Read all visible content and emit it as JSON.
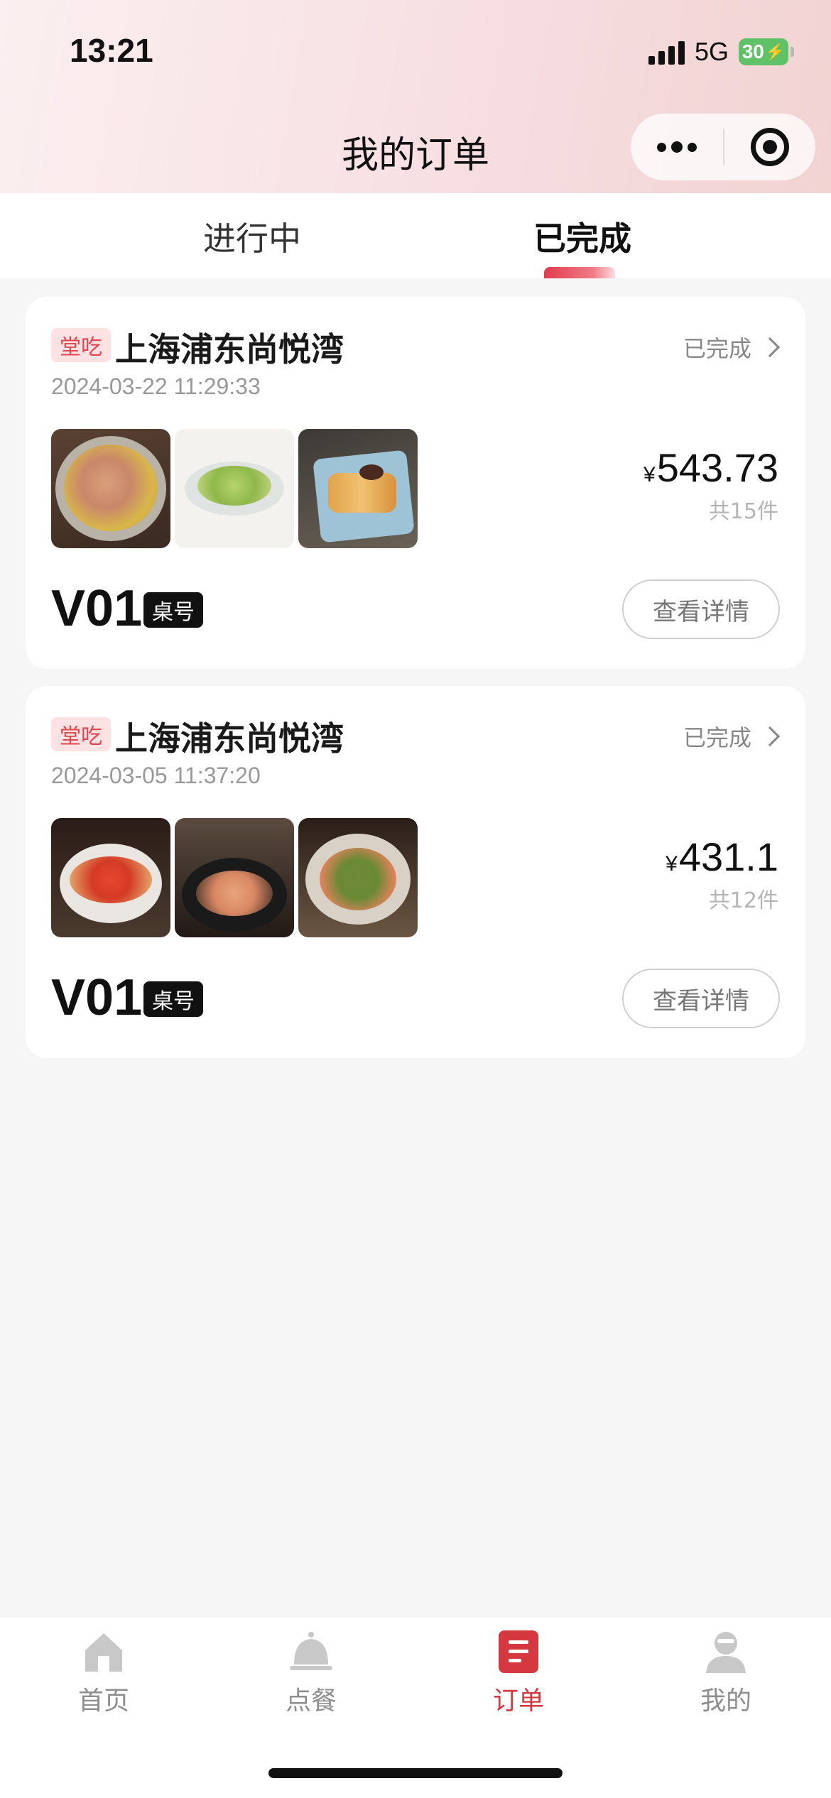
{
  "status_bar": {
    "time": "13:21",
    "network": "5G",
    "battery": "30"
  },
  "nav": {
    "title": "我的订单"
  },
  "tabs": [
    {
      "label": "进行中",
      "active": false
    },
    {
      "label": "已完成",
      "active": true
    }
  ],
  "orders": [
    {
      "tag": "堂吃",
      "store": "上海浦东尚悦湾",
      "status": "已完成",
      "datetime": "2024-03-22 11:29:33",
      "currency": "¥",
      "amount": "543.73",
      "count": "共15件",
      "table_no": "V01",
      "table_label": "桌号",
      "detail_button": "查看详情"
    },
    {
      "tag": "堂吃",
      "store": "上海浦东尚悦湾",
      "status": "已完成",
      "datetime": "2024-03-05 11:37:20",
      "currency": "¥",
      "amount": "431.1",
      "count": "共12件",
      "table_no": "V01",
      "table_label": "桌号",
      "detail_button": "查看详情"
    }
  ],
  "tabbar": [
    {
      "label": "首页",
      "icon": "home-icon",
      "active": false
    },
    {
      "label": "点餐",
      "icon": "service-bell-icon",
      "active": false
    },
    {
      "label": "订单",
      "icon": "order-icon",
      "active": true
    },
    {
      "label": "我的",
      "icon": "profile-icon",
      "active": false
    }
  ],
  "colors": {
    "accent": "#d6383f",
    "tag_bg": "#fde2e4",
    "background": "#f6f6f6"
  }
}
